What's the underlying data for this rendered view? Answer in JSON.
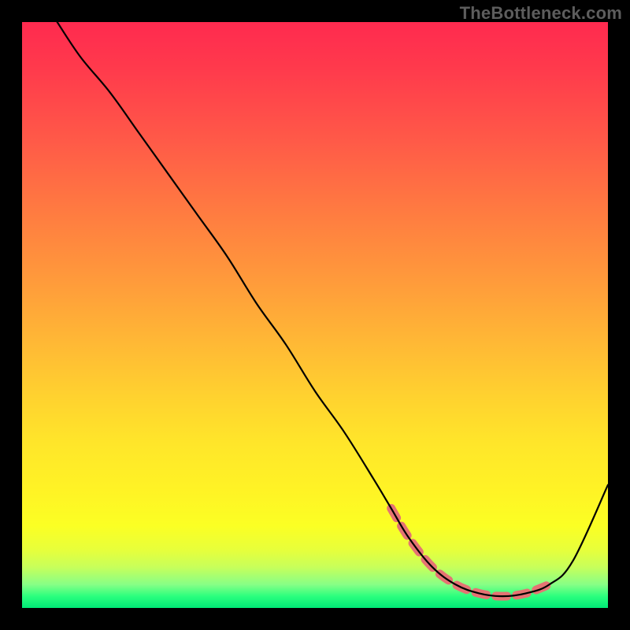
{
  "watermark": "TheBottleneck.com",
  "chart_data": {
    "type": "line",
    "title": "",
    "xlabel": "",
    "ylabel": "",
    "xlim": [
      0,
      100
    ],
    "ylim": [
      0,
      100
    ],
    "grid": false,
    "legend": false,
    "background": "rainbow-vertical-gradient",
    "series": [
      {
        "name": "curve",
        "color": "#000000",
        "x": [
          6,
          10,
          15,
          20,
          25,
          30,
          35,
          40,
          45,
          50,
          55,
          60,
          63,
          66,
          70,
          74,
          78,
          82,
          86,
          90,
          94,
          100
        ],
        "y": [
          100,
          94,
          88,
          81,
          74,
          67,
          60,
          52,
          45,
          37,
          30,
          22,
          17,
          12,
          7,
          4,
          2.5,
          2,
          2.5,
          4,
          8,
          21
        ]
      }
    ],
    "highlight_region": {
      "description": "dashed pink segment near curve minimum",
      "x": [
        63,
        66,
        70,
        74,
        78,
        82,
        86,
        90
      ],
      "y": [
        17,
        12,
        7,
        4,
        2.5,
        2,
        2.5,
        4
      ],
      "color": "#e57373"
    }
  }
}
